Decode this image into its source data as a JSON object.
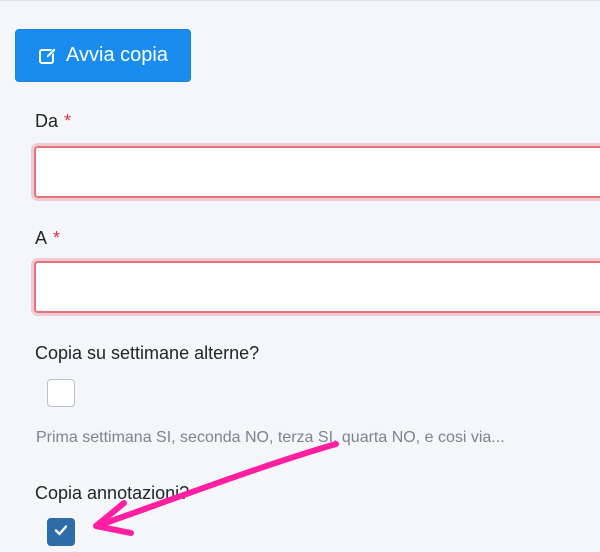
{
  "toolbar": {
    "start_copy_label": "Avvia copia",
    "start_copy_icon": "edit-icon"
  },
  "form": {
    "from": {
      "label": "Da",
      "required_mark": "*",
      "value": ""
    },
    "to": {
      "label": "A",
      "required_mark": "*",
      "value": ""
    },
    "alternate_weeks": {
      "label": "Copia su settimane alterne?",
      "checked": false,
      "hint": "Prima settimana SI, seconda NO, terza SI, quarta NO, e cosi via..."
    },
    "copy_annotations": {
      "label": "Copia annotazioni?",
      "checked": true
    }
  },
  "annotation": {
    "arrow_color": "#ff1fa0"
  },
  "colors": {
    "primary": "#1a8cf0",
    "required": "#dc3545",
    "checkbox_checked": "#2e6ca8"
  }
}
